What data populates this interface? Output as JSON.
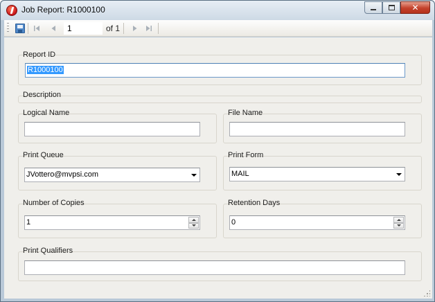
{
  "window": {
    "title": "Job Report: R1000100",
    "icon": "app-logo-icon"
  },
  "toolbar": {
    "page_current": "1",
    "page_of": "of 1",
    "icons": [
      "save-icon",
      "first-page-icon",
      "previous-page-icon",
      "next-page-icon",
      "last-page-icon"
    ]
  },
  "form": {
    "report_id": {
      "label": "Report ID",
      "value": "R1000100"
    },
    "description": {
      "label": "Description"
    },
    "logical_name": {
      "label": "Logical Name",
      "value": ""
    },
    "file_name": {
      "label": "File Name",
      "value": ""
    },
    "print_queue": {
      "label": "Print Queue",
      "value": "JVottero@mvpsi.com"
    },
    "print_form": {
      "label": "Print Form",
      "value": "MAIL"
    },
    "number_of_copies": {
      "label": "Number of Copies",
      "value": "1"
    },
    "retention_days": {
      "label": "Retention Days",
      "value": "0"
    },
    "print_qualifiers": {
      "label": "Print Qualifiers",
      "value": ""
    }
  },
  "colors": {
    "frame": "#b9c9d8",
    "content_bg": "#f0efeb",
    "selection": "#3399ff",
    "close_button": "#c4412b"
  }
}
